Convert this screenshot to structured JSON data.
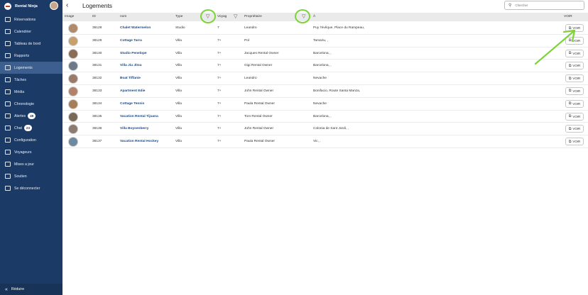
{
  "sidebar": {
    "brand": "Rental Ninja",
    "items": [
      {
        "label": "Réservations",
        "icon": "calendar-list-icon"
      },
      {
        "label": "Calendrier",
        "icon": "calendar-icon"
      },
      {
        "label": "Tableau de bord",
        "icon": "dashboard-icon"
      },
      {
        "label": "Rapports",
        "icon": "bar-chart-icon"
      },
      {
        "label": "Logements",
        "icon": "buildings-icon",
        "active": true
      },
      {
        "label": "Tâches",
        "icon": "checklist-icon"
      },
      {
        "label": "Média",
        "icon": "image-icon"
      },
      {
        "label": "Chronologie",
        "icon": "timeline-icon"
      },
      {
        "label": "Alertes",
        "icon": "gear-alert-icon",
        "badge": "49"
      },
      {
        "label": "Chat",
        "icon": "chat-icon",
        "badge": "23"
      },
      {
        "label": "Configuration",
        "icon": "sliders-icon"
      },
      {
        "label": "Voyageurs",
        "icon": "people-icon"
      },
      {
        "label": "Mises a jour",
        "icon": "updates-icon"
      },
      {
        "label": "Soutien",
        "icon": "help-icon"
      },
      {
        "label": "Se déconnecter",
        "icon": "logout-icon"
      }
    ],
    "footer": "Réduire"
  },
  "header": {
    "title": "Logements",
    "search_placeholder": "Chercher"
  },
  "table": {
    "columns": {
      "image": "Image",
      "id": "ID",
      "nom": "nom",
      "type": "Type",
      "voyag": "Voyag",
      "proprietaire": "Propriétaire",
      "a": "À",
      "voir": "VOIR"
    },
    "button_label": "VOIR",
    "rows": [
      {
        "id": "38128",
        "nom": "Chalet Watermelon",
        "type": "Studio",
        "voyag": "7",
        "owner": "Leandro",
        "a": "Puy l'évêque, Place du Rampeau,"
      },
      {
        "id": "38129",
        "nom": "Cottage Tarra",
        "type": "Villa",
        "voyag": "7+",
        "owner": "Pol",
        "a": "Tamariu, ,"
      },
      {
        "id": "38130",
        "nom": "Studio Penelope",
        "type": "Villa",
        "voyag": "7+",
        "owner": "Jacques Rental Owner",
        "a": "Barcelona, ,"
      },
      {
        "id": "38131",
        "nom": "Villa Jiu Jitsu",
        "type": "Villa",
        "voyag": "7+",
        "owner": "Gigi Rental Owner",
        "a": "Barcelona, ,"
      },
      {
        "id": "38132",
        "nom": "Boat Tiffanie",
        "type": "Villa",
        "voyag": "7+",
        "owner": "Leandro",
        "a": "Nevache"
      },
      {
        "id": "38133",
        "nom": "Apartment Edie",
        "type": "Villa",
        "voyag": "7+",
        "owner": "John Rental Owner",
        "a": "Bonifacio, Route Santa Manza,"
      },
      {
        "id": "38134",
        "nom": "Cottage Tennis",
        "type": "Villa",
        "voyag": "7+",
        "owner": "Paula Rental Owner",
        "a": "Nevache"
      },
      {
        "id": "38135",
        "nom": "Vacation Rental Tijuana",
        "type": "Villa",
        "voyag": "7+",
        "owner": "Tom Rental Owner",
        "a": "Barcelona, ,"
      },
      {
        "id": "38136",
        "nom": "Villa Boysenberry",
        "type": "Villa",
        "voyag": "7+",
        "owner": "John Rental Owner",
        "a": "Colonia de Sant Jordi, ,"
      },
      {
        "id": "38137",
        "nom": "Vacation Rental Hockey",
        "type": "Villa",
        "voyag": "7+",
        "owner": "Paula Rental Owner",
        "a": "Vic, ,"
      }
    ]
  },
  "colors": {
    "sidebar_bg": "#1b3a66",
    "active_item": "#3c5f90",
    "highlight": "#7ed23a",
    "link": "#1c4a86"
  }
}
